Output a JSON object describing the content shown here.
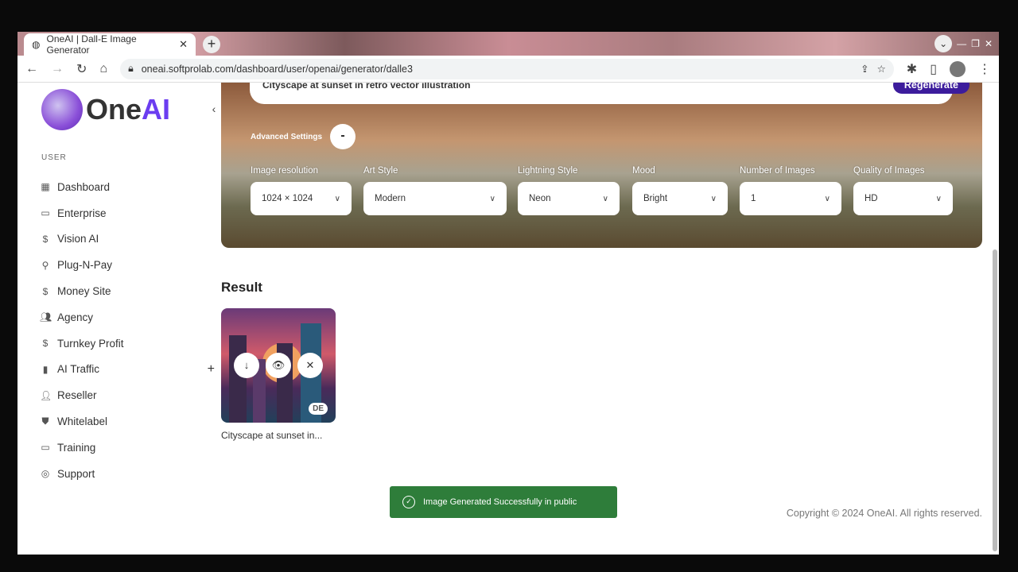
{
  "browser": {
    "tab_title": "OneAI | Dall-E Image Generator",
    "url": "oneai.softprolab.com/dashboard/user/openai/generator/dalle3"
  },
  "logo": {
    "text": "One",
    "accent": "AI"
  },
  "sidebar": {
    "section": "USER",
    "items": [
      {
        "label": "Dashboard",
        "icon": "grid-icon"
      },
      {
        "label": "Enterprise",
        "icon": "laptop-icon"
      },
      {
        "label": "Vision AI",
        "icon": "dollar-icon"
      },
      {
        "label": "Plug-N-Pay",
        "icon": "link-icon"
      },
      {
        "label": "Money Site",
        "icon": "dollar-icon"
      },
      {
        "label": "Agency",
        "icon": "users-icon"
      },
      {
        "label": "Turnkey Profit",
        "icon": "dollar-icon"
      },
      {
        "label": "AI Traffic",
        "icon": "battery-icon"
      },
      {
        "label": "Reseller",
        "icon": "user-plus-icon"
      },
      {
        "label": "Whitelabel",
        "icon": "shield-icon"
      },
      {
        "label": "Training",
        "icon": "laptop-icon"
      },
      {
        "label": "Support",
        "icon": "lifebuoy-icon"
      }
    ]
  },
  "generator": {
    "prompt": "Cityscape at sunset in retro vector illustration",
    "regenerate": "Regenerate",
    "advanced": "Advanced Settings",
    "advanced_toggle": "-",
    "fields": [
      {
        "label": "Image resolution",
        "value": "1024 × 1024"
      },
      {
        "label": "Art Style",
        "value": "Modern"
      },
      {
        "label": "Lightning Style",
        "value": "Neon"
      },
      {
        "label": "Mood",
        "value": "Bright"
      },
      {
        "label": "Number of Images",
        "value": "1"
      },
      {
        "label": "Quality of Images",
        "value": "HD"
      }
    ]
  },
  "result": {
    "heading": "Result",
    "caption": "Cityscape at sunset in...",
    "badge": "DE"
  },
  "toast": "Image Generated Successfully in public",
  "footer": "Copyright © 2024 OneAI. All rights reserved.",
  "colors": {
    "accent": "#3c1c9c",
    "toast": "#2e7d3a"
  }
}
